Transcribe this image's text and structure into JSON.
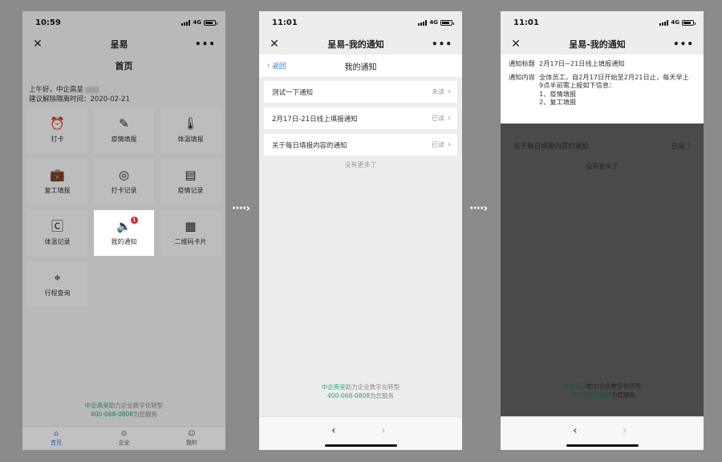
{
  "screen1": {
    "time": "10:59",
    "network": "4G",
    "app_title": "呈易",
    "page_title": "首页",
    "greeting": "上午好，中企高呈",
    "quarantine_line": "建议解除隔离时间：2020-02-21",
    "tiles": [
      {
        "label": "打卡",
        "icon": "alarm-clock-icon"
      },
      {
        "label": "疫情填报",
        "icon": "pen-icon"
      },
      {
        "label": "体温填报",
        "icon": "thermometer-icon"
      },
      {
        "label": "复工填报",
        "icon": "briefcase-icon"
      },
      {
        "label": "打卡记录",
        "icon": "fingerprint-icon"
      },
      {
        "label": "疫情记录",
        "icon": "document-icon"
      },
      {
        "label": "体温记录",
        "icon": "calendar-c-icon"
      },
      {
        "label": "我的通知",
        "icon": "speaker-icon",
        "badge": "1"
      },
      {
        "label": "二维码卡片",
        "icon": "qr-code-icon"
      },
      {
        "label": "行程查询",
        "icon": "location-pin-icon"
      }
    ],
    "footer_line1_green": "中企高呈",
    "footer_line1_rest": "助力企业数字化转型",
    "footer_line2_green": "400-068-0808",
    "footer_line2_rest": "为您服务",
    "tabs": [
      {
        "label": "首页",
        "active": true
      },
      {
        "label": "企业",
        "active": false
      },
      {
        "label": "我的",
        "active": false
      }
    ]
  },
  "screen2": {
    "time": "11:01",
    "network": "4G",
    "app_title": "呈易-我的通知",
    "back_label": "返回",
    "sub_title": "我的通知",
    "notifications": [
      {
        "title": "测试一下通知",
        "status": "未读"
      },
      {
        "title": "2月17日-21日线上填报通知",
        "status": "已读"
      },
      {
        "title": "关于每日填报内容的通知",
        "status": "已读"
      }
    ],
    "no_more": "没有更多了",
    "footer_line1_green": "中企高呈",
    "footer_line1_rest": "助力企业数字化转型",
    "footer_line2_green": "400-068-0808",
    "footer_line2_rest": "为您服务"
  },
  "screen3": {
    "time": "11:01",
    "network": "4G",
    "app_title": "呈易-我的通知",
    "title_label": "通知标题",
    "title_value": "2月17日~21日线上填报通知",
    "content_label": "通知内容",
    "content_lines": [
      "全体员工，自2月17日开始至2月21日止，每天早上",
      "9点半前需上报如下信息：",
      "1、疫情填报",
      "2、复工填报"
    ],
    "bg_row_title": "关于每日填报内容的通知",
    "bg_row_status": "已读",
    "no_more": "没有更多了",
    "footer_line1_green": "中企高呈",
    "footer_line1_rest": "助力企业数字化转型",
    "footer_line2_green": "400-068-0808",
    "footer_line2_rest": "为您服务"
  },
  "colors": {
    "page_bg": "#8a8b8d",
    "accent_blue": "#2a7ae2",
    "brand_green": "#1aad5f",
    "badge_red": "#e02020"
  }
}
